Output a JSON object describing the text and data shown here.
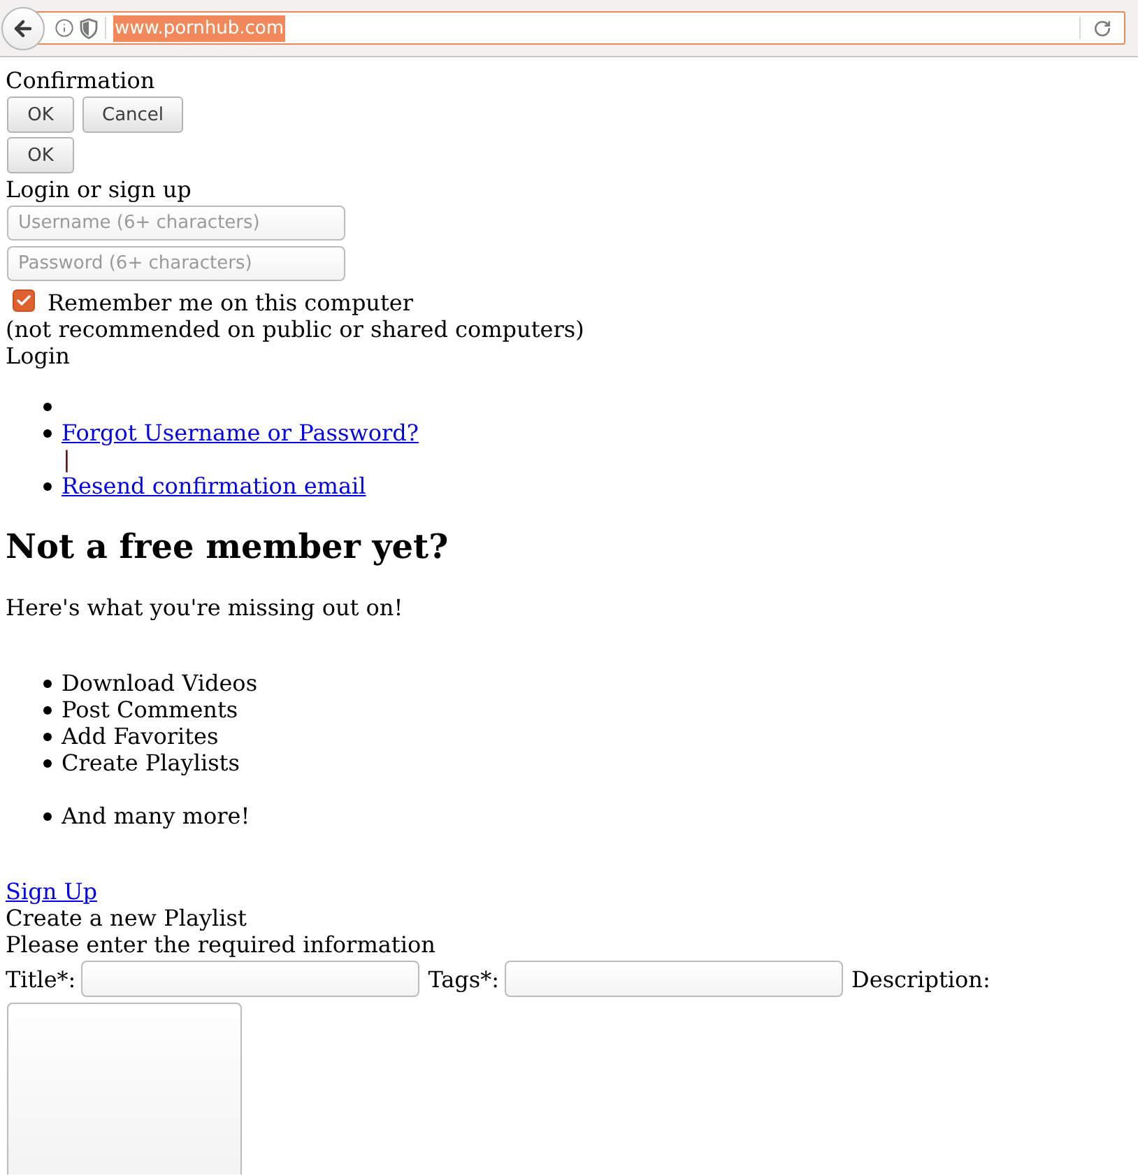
{
  "browser": {
    "url": "www.pornhub.com",
    "url_selected": true
  },
  "confirmation": {
    "title": "Confirmation",
    "buttons": [
      "OK",
      "Cancel"
    ]
  },
  "alert": {
    "button": "OK"
  },
  "login": {
    "title": "Login or sign up",
    "fields": [
      {
        "placeholder": "Username (6+ characters)"
      },
      {
        "placeholder": "Password (6+ characters)"
      }
    ],
    "remember": {
      "label": "Remember me on this computer",
      "checked": true
    },
    "note": "(not recommended on public or shared computers)",
    "submit": "Login",
    "links": [
      {
        "kind": "blank"
      },
      {
        "kind": "link",
        "text": "Forgot Username or Password?",
        "separator": "|"
      },
      {
        "kind": "link",
        "text": "Resend confirmation email"
      }
    ]
  },
  "signup": {
    "heading": "Not a free member yet?",
    "intro": "Here's what you're missing out on!",
    "benefit_lists": [
      {
        "items": [
          "Download Videos",
          "Post Comments",
          "Add Favorites",
          "Create Playlists"
        ]
      },
      {
        "items": [
          "And many more!"
        ]
      }
    ],
    "link": "Sign Up"
  },
  "playlist": {
    "title": "Create a new Playlist",
    "instructions": "Please enter the required information",
    "fields": [
      {
        "kind": "input",
        "label": "Title*:"
      },
      {
        "kind": "input",
        "label": "Tags*:"
      },
      {
        "kind": "textarea",
        "label": "Description:"
      }
    ]
  }
}
